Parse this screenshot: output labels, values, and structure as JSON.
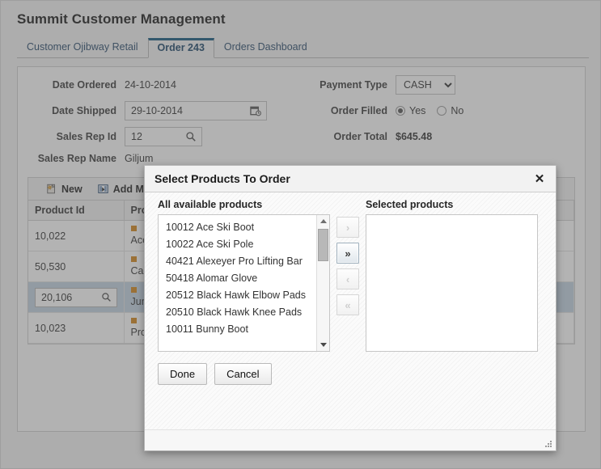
{
  "app": {
    "title": "Summit Customer Management",
    "tabs": [
      {
        "label": "Customer Ojibway Retail",
        "active": false
      },
      {
        "label": "Order 243",
        "active": true
      },
      {
        "label": "Orders Dashboard",
        "active": false
      }
    ]
  },
  "form": {
    "date_ordered_label": "Date Ordered",
    "date_ordered_value": "24-10-2014",
    "date_shipped_label": "Date Shipped",
    "date_shipped_value": "29-10-2014",
    "sales_rep_id_label": "Sales Rep Id",
    "sales_rep_id_value": "12",
    "sales_rep_name_label": "Sales Rep Name",
    "sales_rep_name_value": "Giljum",
    "payment_type_label": "Payment Type",
    "payment_type_value": "CASH",
    "payment_type_options": [
      "CASH"
    ],
    "order_filled_label": "Order Filled",
    "order_filled_yes": "Yes",
    "order_filled_no": "No",
    "order_filled_selected": "Yes",
    "order_total_label": "Order Total",
    "order_total_value": "$645.48"
  },
  "table": {
    "toolbar": [
      {
        "label": "New",
        "icon": "new-page-icon"
      },
      {
        "label": "Add M",
        "icon": "add-multiple-icon"
      }
    ],
    "columns": [
      "Product Id",
      "Prod"
    ],
    "rows": [
      {
        "product_id": "10,022",
        "product_name": "Ace ",
        "editing": false,
        "selected": false
      },
      {
        "product_id": "50,530",
        "product_name": "Cabr",
        "editing": false,
        "selected": false
      },
      {
        "product_id": "20,106",
        "product_name": "Junio",
        "editing": true,
        "selected": true
      },
      {
        "product_id": "10,023",
        "product_name": "Pro S",
        "editing": false,
        "selected": false
      }
    ]
  },
  "dialog": {
    "title": "Select Products To Order",
    "close_label": "✕",
    "available_label": "All available products",
    "selected_label": "Selected products",
    "available_items": [
      "10012 Ace Ski Boot",
      "10022 Ace Ski Pole",
      "40421 Alexeyer Pro Lifting Bar",
      "50418 Alomar Glove",
      "20512 Black Hawk Elbow Pads",
      "20510 Black Hawk Knee Pads",
      "10011 Bunny Boot"
    ],
    "selected_items": [],
    "move_buttons": [
      {
        "name": "move-right-one",
        "glyph": "›",
        "enabled": false
      },
      {
        "name": "move-right-all",
        "glyph": "»",
        "enabled": true
      },
      {
        "name": "move-left-one",
        "glyph": "‹",
        "enabled": false
      },
      {
        "name": "move-left-all",
        "glyph": "«",
        "enabled": false
      }
    ],
    "done_label": "Done",
    "cancel_label": "Cancel"
  },
  "colors": {
    "accent": "#14577f",
    "tab_text": "#2a4a6b",
    "row_selected": "#c3d3e2",
    "marker": "#d2861b"
  }
}
